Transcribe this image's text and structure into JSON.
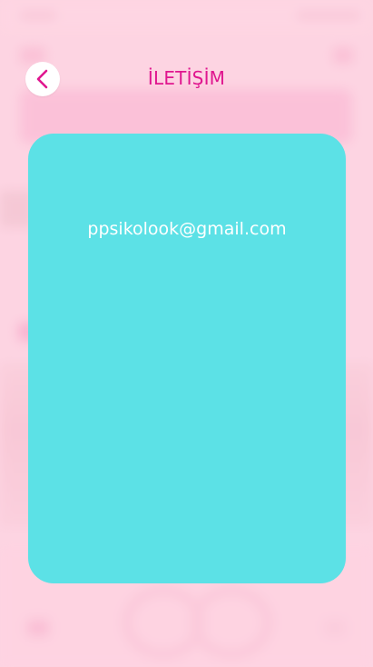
{
  "header": {
    "title": "İLETİŞİM",
    "back_icon": "chevron-left-icon"
  },
  "contact": {
    "email": "ppsikolook@gmail.com"
  },
  "colors": {
    "accent": "#e0168f",
    "card": "#5ce1e6",
    "background": "#fbd3e0",
    "text_on_card": "#ffffff"
  }
}
